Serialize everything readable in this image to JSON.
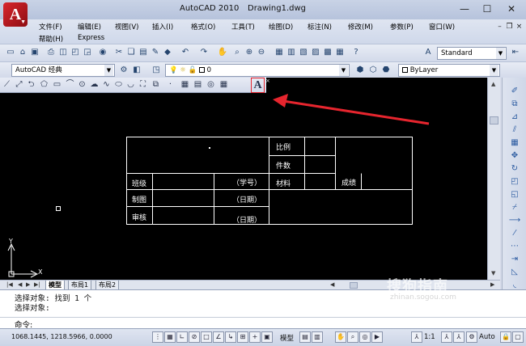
{
  "window": {
    "app_title": "AutoCAD 2010",
    "doc_title": "Drawing1.dwg",
    "min": "—",
    "max": "☐",
    "close": "✕"
  },
  "logo_letter": "A",
  "menu": {
    "row1": [
      "文件(F)",
      "编辑(E)",
      "视图(V)",
      "插入(I)",
      "格式(O)",
      "工具(T)",
      "绘图(D)",
      "标注(N)",
      "修改(M)",
      "参数(P)",
      "窗口(W)"
    ],
    "row2": [
      "帮助(H)",
      "Express"
    ]
  },
  "toolbar": {
    "text_style": "Standard",
    "workspace": "AutoCAD 经典",
    "layer": "0",
    "color": "ByLayer"
  },
  "table": {
    "scale": "比例",
    "quantity": "件数",
    "class": "班级",
    "student_id": "（学号）",
    "material": "材料",
    "grade": "成绩",
    "drawn": "制图",
    "date1": "（日期）",
    "review": "审核",
    "date2": "（日期）"
  },
  "ucs": {
    "x": "X",
    "y": "Y"
  },
  "tabs": [
    "模型",
    "布局1",
    "布局2"
  ],
  "command": {
    "line1": "选择对象: 找到 1 个",
    "line2": "选择对象:",
    "prompt": "命令:"
  },
  "status": {
    "coords": "1068.1445, 1218.5966, 0.0000",
    "model": "模型",
    "scale": "1:1",
    "auto": "Auto"
  },
  "watermark": "搜狗指南",
  "watermark_url": "zhinan.sogou.com",
  "colors": {
    "annotation_arrow": "#e6252e",
    "canvas": "#000000",
    "table_lines": "#ffffff"
  }
}
